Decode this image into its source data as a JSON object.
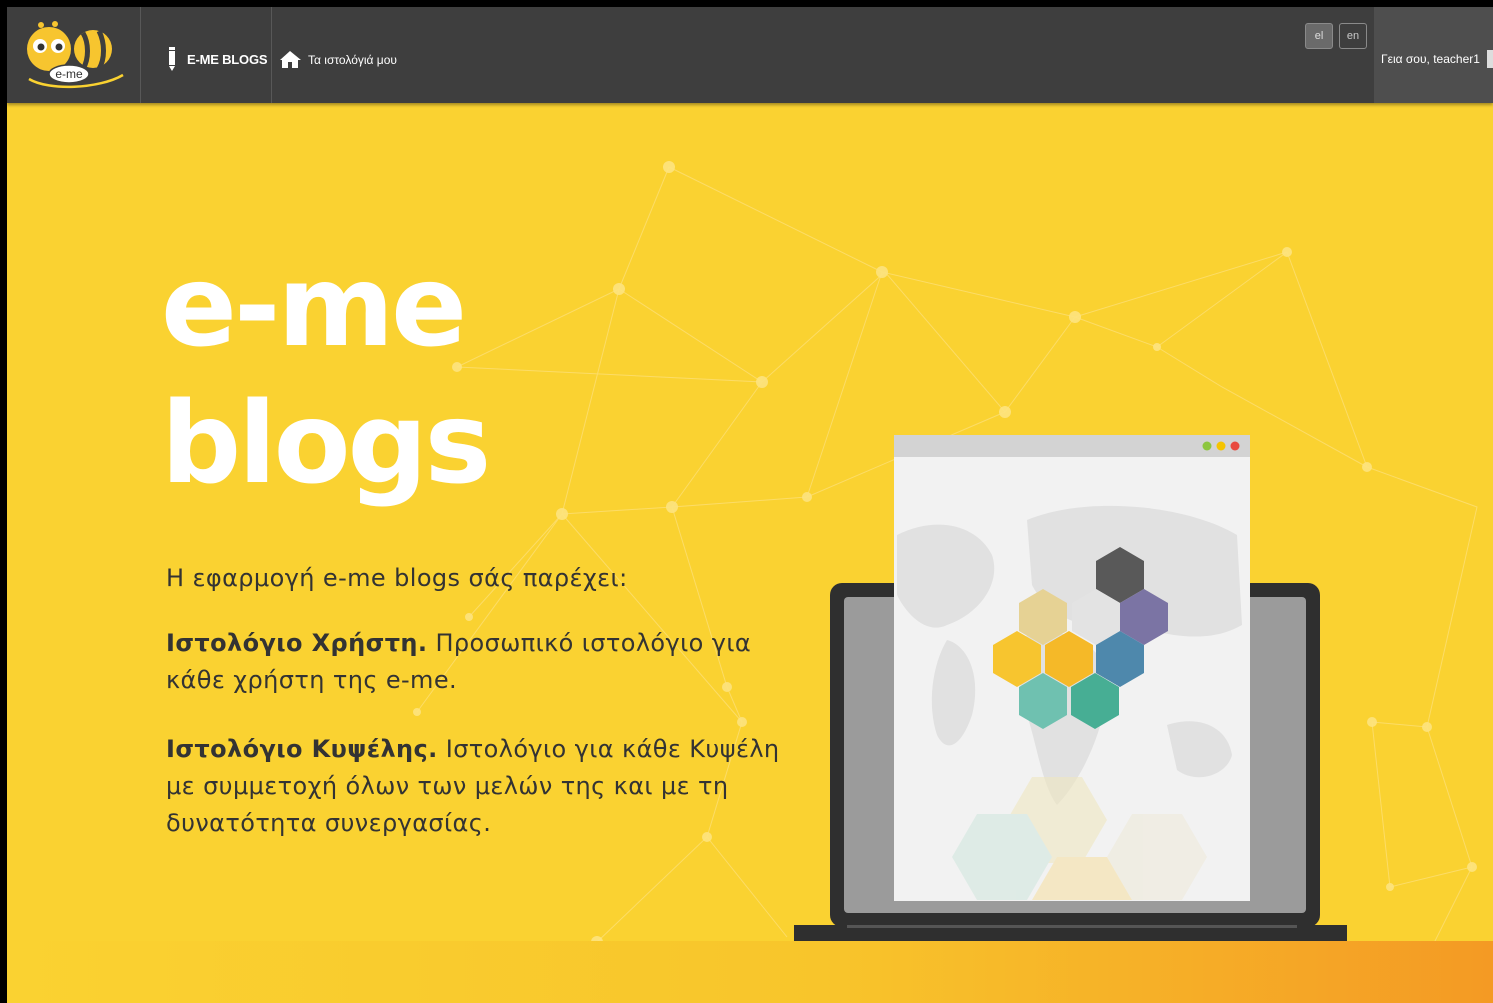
{
  "navbar": {
    "logo_text": "e-me",
    "brand_label": "E-ME BLOGS",
    "my_blogs_label": "Τα ιστολόγιά μου",
    "languages": [
      "el",
      "en"
    ],
    "active_language": "el",
    "greeting": "Γεια σου, teacher1"
  },
  "hero": {
    "title_line1": "e-me",
    "title_line2": "blogs",
    "intro": "Η εφαρμογή e-me blogs σάς παρέχει:",
    "features": [
      {
        "title": "Ιστολόγιο Χρήστη.",
        "text": "Προσωπικό ιστολόγιο για κάθε χρήστη της e-me."
      },
      {
        "title": "Ιστολόγιο Κυψέλης.",
        "text": "Ιστολόγιο για κάθε Κυψέλη με συμμετοχή όλων των μελών της και με τη δυνατότητα συνεργασίας."
      }
    ]
  },
  "colors": {
    "background": "#fad231",
    "navbar": "#3e3e3e",
    "hex_dark": "#595959",
    "hex_purple": "#7b74a4",
    "hex_blue": "#4e88ac",
    "hex_yellow": "#f7c52f",
    "hex_teal": "#47ae94",
    "hex_mint": "#6fc1b0",
    "hex_beige": "#e6d294",
    "window_dots": [
      "#8dc63f",
      "#f5c400",
      "#e8493f"
    ]
  }
}
